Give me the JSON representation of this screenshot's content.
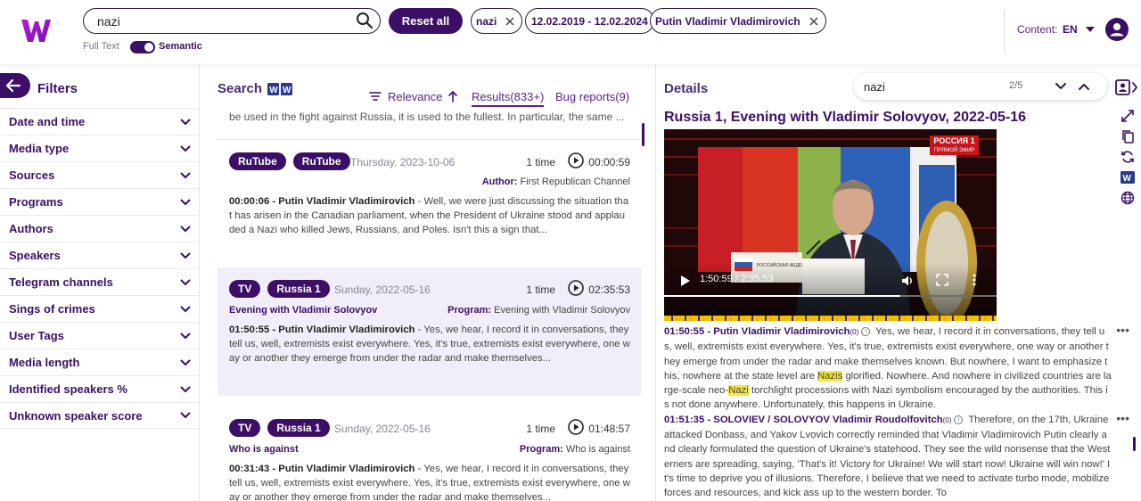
{
  "colors": {
    "primary": "#3b0f66",
    "accent": "#5a1e8c",
    "highlight": "#f5e63a"
  },
  "header": {
    "search_value": "nazi",
    "reset_label": "Reset all",
    "chips": [
      {
        "label": "nazi"
      },
      {
        "label": "12.02.2019 - 12.02.2024"
      },
      {
        "label": "Putin Vladimir Vladimirovich"
      }
    ],
    "toggle_left": "Full Text",
    "toggle_right": "Semantic",
    "content_label": "Content:",
    "content_value": "EN"
  },
  "filters": {
    "title": "Filters",
    "items": [
      "Date and time",
      "Media type",
      "Sources",
      "Programs",
      "Authors",
      "Speakers",
      "Telegram channels",
      "Sings of crimes",
      "User Tags",
      "Media length",
      "Identified speakers %",
      "Unknown speaker score"
    ]
  },
  "results": {
    "title": "Search",
    "sort_label": "Relevance",
    "tabs": [
      "Results(833+)",
      "Bug reports(9)"
    ],
    "top_snippet": "be used in the fight against Russia, it is used to the fullest. In particular, the same ...",
    "cards": [
      {
        "badges": [
          "RuTube",
          "RuTube"
        ],
        "date": "Thursday, 2023-10-06",
        "times": "1 time",
        "duration": "00:00:59",
        "left_label": "",
        "right_key": "Author:",
        "right_value": "First Republican Channel",
        "timestamp": "00:00:06",
        "speaker": "Putin Vladimir Vladimirovich",
        "text": "Well, we were just discussing the situation that has arisen in the Canadian parliament, when the President of Ukraine stood and applauded a Nazi who killed Jews, Russians, and Poles. Isn't this a sign that..."
      },
      {
        "badges": [
          "TV",
          "Russia 1"
        ],
        "date": "Sunday, 2022-05-16",
        "times": "1 time",
        "duration": "02:35:53",
        "left_label": "Evening with Vladimir Solovyov",
        "right_key": "Program:",
        "right_value": "Evening with Vladimir Solovyov",
        "timestamp": "01:50:55",
        "speaker": "Putin Vladimir Vladimirovich",
        "text": "Yes, we hear, I record it in conversations, they tell us, well, extremists exist everywhere. Yes, it's true, extremists exist everywhere, one way or another they emerge from under the radar and make themselves..."
      },
      {
        "badges": [
          "TV",
          "Russia 1"
        ],
        "date": "Sunday, 2022-05-16",
        "times": "1 time",
        "duration": "01:48:57",
        "left_label": "Who is against",
        "right_key": "Program:",
        "right_value": "Who is against",
        "timestamp": "00:31:43",
        "speaker": "Putin Vladimir Vladimirovich",
        "text": "Yes, we hear, I record it in conversations, they tell us, well, extremists exist everywhere. Yes, it's true, extremists exist everywhere, one way or another they emerge from under the radar and make themselves..."
      }
    ]
  },
  "details": {
    "title": "Details",
    "search_value": "nazi",
    "match_count": "2/5",
    "heading": "Russia 1, Evening with Vladimir Solovyov, 2022-05-16",
    "video": {
      "channel": "РОССИЯ 1",
      "channel_sub": "ПРЯМОЙ ЭФИР",
      "nameplate": "РОССИЙСКАЯ ФЕДЕРАЦИЯ",
      "time": "1:50:59 / 2:35:53",
      "progress": 0.71
    },
    "transcript": [
      {
        "timestamp": "01:50:55",
        "speaker": "Putin Vladimir Vladimirovich",
        "count": "(0)",
        "t1": "Yes, we hear, I record it in conversations, they tell us, well, extremists exist everywhere. Yes, it's true, extremists exist everywhere, one way or another they emerge from under the radar and make themselves known. But nowhere, I want to emphasize this, nowhere at the state level are ",
        "m1": "Nazis",
        "t2": " glorified. Nowhere. And nowhere in civilized countries are large-scale neo-",
        "m2": "Nazi",
        "t3": " torchlight processions with Nazi symbolism encouraged by the authorities. This is not done anywhere. Unfortunately, this happens in Ukraine."
      },
      {
        "timestamp": "01:51:35",
        "speaker": "SOLOVIEV / SOLOVYOV Vladimir Roudolfovitch",
        "count": "(0)",
        "t1": "Therefore, on the 17th, Ukraine attacked Donbass, and Yakov Lvovich correctly reminded that Vladimir Vladimirovich Putin clearly and clearly formulated the question of Ukraine's statehood. They see the wild nonsense that the Westerners are spreading, saying, 'That's it! Victory for Ukraine! We will start now! Ukraine will win now!' It's time to deprive you of illusions. Therefore, I believe that we need to activate turbo mode, mobilize forces and resources, and kick ass up to the western border. To",
        "m1": "",
        "t2": "",
        "m2": "",
        "t3": ""
      }
    ]
  }
}
